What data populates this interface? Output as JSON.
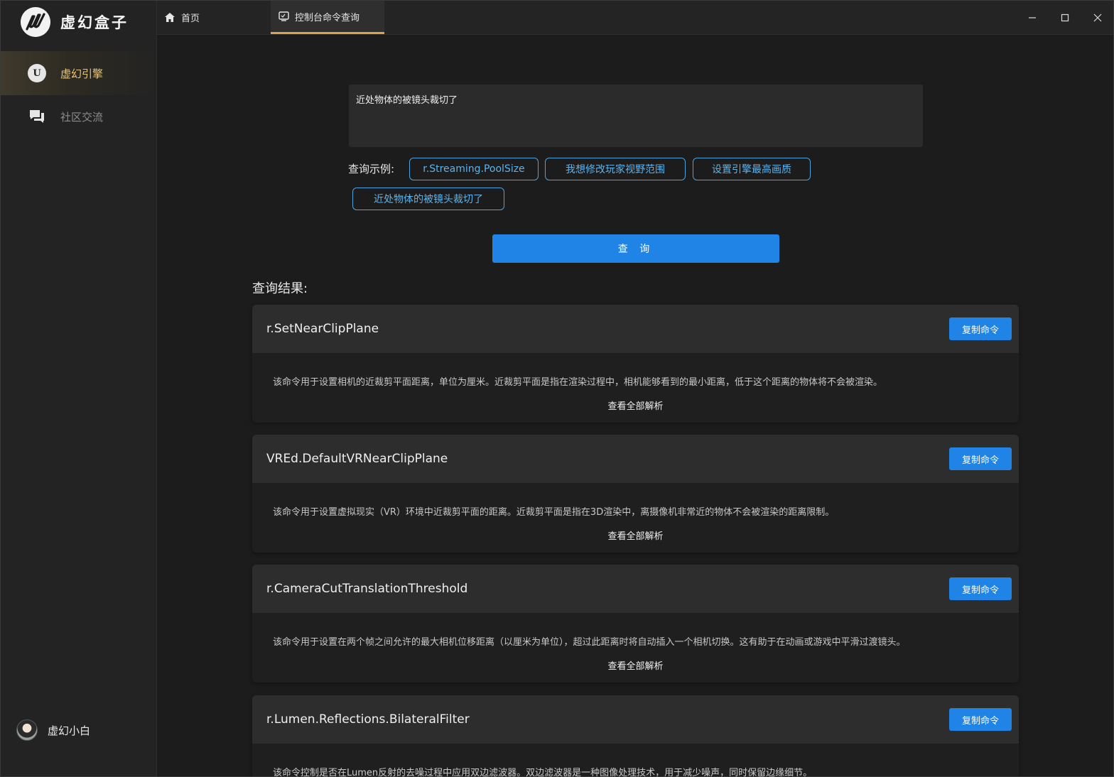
{
  "app": {
    "name": "虚幻盒子"
  },
  "sidebar": {
    "items": [
      {
        "label": "虚幻引擎",
        "icon": "unreal-engine-icon",
        "active": true
      },
      {
        "label": "社区交流",
        "icon": "chat-bubbles-icon",
        "active": false
      }
    ],
    "user": {
      "name": "虚幻小白"
    }
  },
  "tabs": [
    {
      "label": "首页",
      "icon": "home-icon",
      "active": false
    },
    {
      "label": "控制台命令查询",
      "icon": "console-icon",
      "active": true
    }
  ],
  "query": {
    "value": "近处物体的被镜头裁切了",
    "examples_label": "查询示例:",
    "examples": [
      "r.Streaming.PoolSize",
      "我想修改玩家视野范围",
      "设置引擎最高画质",
      "近处物体的被镜头裁切了"
    ],
    "search_label": "查 询"
  },
  "results": {
    "title": "查询结果:",
    "copy_label": "复制命令",
    "more_label": "查看全部解析",
    "items": [
      {
        "command": "r.SetNearClipPlane",
        "description": "该命令用于设置相机的近裁剪平面距离，单位为厘米。近裁剪平面是指在渲染过程中，相机能够看到的最小距离，低于这个距离的物体将不会被渲染。"
      },
      {
        "command": "VREd.DefaultVRNearClipPlane",
        "description": "该命令用于设置虚拟现实（VR）环境中近裁剪平面的距离。近裁剪平面是指在3D渲染中，离摄像机非常近的物体不会被渲染的距离限制。"
      },
      {
        "command": "r.CameraCutTranslationThreshold",
        "description": "该命令用于设置在两个帧之间允许的最大相机位移距离（以厘米为单位），超过此距离时将自动插入一个相机切换。这有助于在动画或游戏中平滑过渡镜头。"
      },
      {
        "command": "r.Lumen.Reflections.BilateralFilter",
        "description": "该命令控制是否在Lumen反射的去噪过程中应用双边滤波器。双边滤波器是一种图像处理技术，用于减少噪声，同时保留边缘细节。"
      }
    ]
  },
  "colors": {
    "accent_blue": "#1f84e6",
    "chip_blue": "#5fb2ea",
    "active_gold": "#e8c57a",
    "tab_underline": "#d9a44a"
  }
}
